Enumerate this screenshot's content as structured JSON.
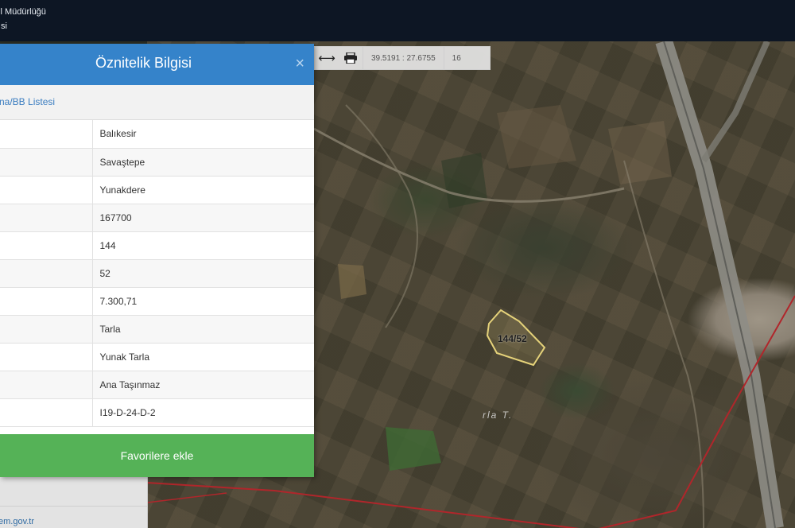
{
  "topbar": {
    "line1": "il Müdürlüğü",
    "line2": "ısi"
  },
  "map": {
    "coordinates": "39.5191 : 27.6755",
    "zoom": "16",
    "parcel_label": "144/52",
    "map_text": "rla T."
  },
  "panel": {
    "title": "Öznitelik Bilgisi",
    "close_symbol": "×",
    "subheader": "na/BB Listesi",
    "rows": [
      {
        "value": "Balıkesir"
      },
      {
        "value": "Savaştepe"
      },
      {
        "value": "Yunakdere"
      },
      {
        "value": "167700"
      },
      {
        "value": "144"
      },
      {
        "value": "52"
      },
      {
        "value": "7.300,71"
      },
      {
        "value": "Tarla"
      },
      {
        "value": "Yunak Tarla"
      },
      {
        "value": "Ana Taşınmaz"
      },
      {
        "value": "I19-D-24-D-2"
      }
    ],
    "favorite_button": "Favorilere ekle"
  },
  "footer": {
    "link": "em.gov.tr"
  },
  "colors": {
    "header_blue": "#3583ca",
    "button_green": "#55b257",
    "topbar_dark": "#0d1624",
    "boundary_red": "#b0262b",
    "parcel_outline": "#e5d27a"
  }
}
